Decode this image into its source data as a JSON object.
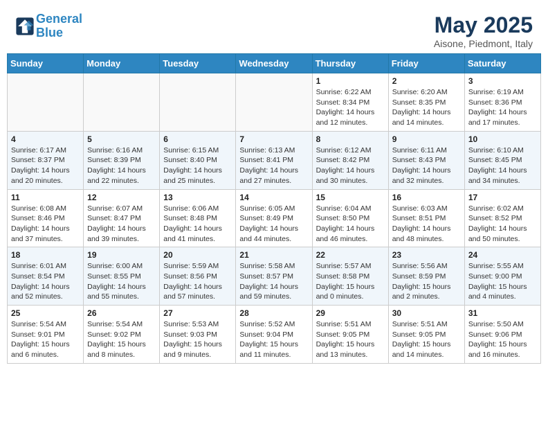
{
  "header": {
    "logo_line1": "General",
    "logo_line2": "Blue",
    "month": "May 2025",
    "location": "Aisone, Piedmont, Italy"
  },
  "days_of_week": [
    "Sunday",
    "Monday",
    "Tuesday",
    "Wednesday",
    "Thursday",
    "Friday",
    "Saturday"
  ],
  "weeks": [
    [
      {
        "day": "",
        "info": ""
      },
      {
        "day": "",
        "info": ""
      },
      {
        "day": "",
        "info": ""
      },
      {
        "day": "",
        "info": ""
      },
      {
        "day": "1",
        "info": "Sunrise: 6:22 AM\nSunset: 8:34 PM\nDaylight: 14 hours\nand 12 minutes."
      },
      {
        "day": "2",
        "info": "Sunrise: 6:20 AM\nSunset: 8:35 PM\nDaylight: 14 hours\nand 14 minutes."
      },
      {
        "day": "3",
        "info": "Sunrise: 6:19 AM\nSunset: 8:36 PM\nDaylight: 14 hours\nand 17 minutes."
      }
    ],
    [
      {
        "day": "4",
        "info": "Sunrise: 6:17 AM\nSunset: 8:37 PM\nDaylight: 14 hours\nand 20 minutes."
      },
      {
        "day": "5",
        "info": "Sunrise: 6:16 AM\nSunset: 8:39 PM\nDaylight: 14 hours\nand 22 minutes."
      },
      {
        "day": "6",
        "info": "Sunrise: 6:15 AM\nSunset: 8:40 PM\nDaylight: 14 hours\nand 25 minutes."
      },
      {
        "day": "7",
        "info": "Sunrise: 6:13 AM\nSunset: 8:41 PM\nDaylight: 14 hours\nand 27 minutes."
      },
      {
        "day": "8",
        "info": "Sunrise: 6:12 AM\nSunset: 8:42 PM\nDaylight: 14 hours\nand 30 minutes."
      },
      {
        "day": "9",
        "info": "Sunrise: 6:11 AM\nSunset: 8:43 PM\nDaylight: 14 hours\nand 32 minutes."
      },
      {
        "day": "10",
        "info": "Sunrise: 6:10 AM\nSunset: 8:45 PM\nDaylight: 14 hours\nand 34 minutes."
      }
    ],
    [
      {
        "day": "11",
        "info": "Sunrise: 6:08 AM\nSunset: 8:46 PM\nDaylight: 14 hours\nand 37 minutes."
      },
      {
        "day": "12",
        "info": "Sunrise: 6:07 AM\nSunset: 8:47 PM\nDaylight: 14 hours\nand 39 minutes."
      },
      {
        "day": "13",
        "info": "Sunrise: 6:06 AM\nSunset: 8:48 PM\nDaylight: 14 hours\nand 41 minutes."
      },
      {
        "day": "14",
        "info": "Sunrise: 6:05 AM\nSunset: 8:49 PM\nDaylight: 14 hours\nand 44 minutes."
      },
      {
        "day": "15",
        "info": "Sunrise: 6:04 AM\nSunset: 8:50 PM\nDaylight: 14 hours\nand 46 minutes."
      },
      {
        "day": "16",
        "info": "Sunrise: 6:03 AM\nSunset: 8:51 PM\nDaylight: 14 hours\nand 48 minutes."
      },
      {
        "day": "17",
        "info": "Sunrise: 6:02 AM\nSunset: 8:52 PM\nDaylight: 14 hours\nand 50 minutes."
      }
    ],
    [
      {
        "day": "18",
        "info": "Sunrise: 6:01 AM\nSunset: 8:54 PM\nDaylight: 14 hours\nand 52 minutes."
      },
      {
        "day": "19",
        "info": "Sunrise: 6:00 AM\nSunset: 8:55 PM\nDaylight: 14 hours\nand 55 minutes."
      },
      {
        "day": "20",
        "info": "Sunrise: 5:59 AM\nSunset: 8:56 PM\nDaylight: 14 hours\nand 57 minutes."
      },
      {
        "day": "21",
        "info": "Sunrise: 5:58 AM\nSunset: 8:57 PM\nDaylight: 14 hours\nand 59 minutes."
      },
      {
        "day": "22",
        "info": "Sunrise: 5:57 AM\nSunset: 8:58 PM\nDaylight: 15 hours\nand 0 minutes."
      },
      {
        "day": "23",
        "info": "Sunrise: 5:56 AM\nSunset: 8:59 PM\nDaylight: 15 hours\nand 2 minutes."
      },
      {
        "day": "24",
        "info": "Sunrise: 5:55 AM\nSunset: 9:00 PM\nDaylight: 15 hours\nand 4 minutes."
      }
    ],
    [
      {
        "day": "25",
        "info": "Sunrise: 5:54 AM\nSunset: 9:01 PM\nDaylight: 15 hours\nand 6 minutes."
      },
      {
        "day": "26",
        "info": "Sunrise: 5:54 AM\nSunset: 9:02 PM\nDaylight: 15 hours\nand 8 minutes."
      },
      {
        "day": "27",
        "info": "Sunrise: 5:53 AM\nSunset: 9:03 PM\nDaylight: 15 hours\nand 9 minutes."
      },
      {
        "day": "28",
        "info": "Sunrise: 5:52 AM\nSunset: 9:04 PM\nDaylight: 15 hours\nand 11 minutes."
      },
      {
        "day": "29",
        "info": "Sunrise: 5:51 AM\nSunset: 9:05 PM\nDaylight: 15 hours\nand 13 minutes."
      },
      {
        "day": "30",
        "info": "Sunrise: 5:51 AM\nSunset: 9:05 PM\nDaylight: 15 hours\nand 14 minutes."
      },
      {
        "day": "31",
        "info": "Sunrise: 5:50 AM\nSunset: 9:06 PM\nDaylight: 15 hours\nand 16 minutes."
      }
    ]
  ]
}
